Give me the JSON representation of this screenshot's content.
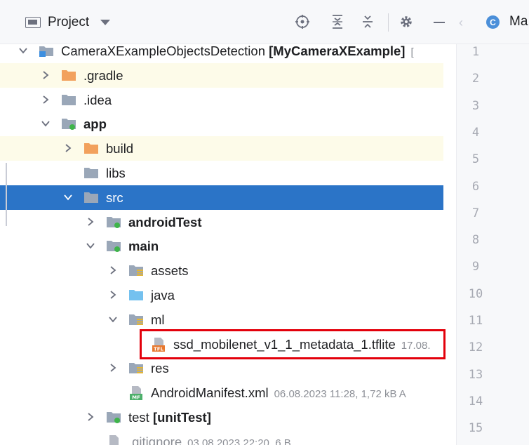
{
  "header": {
    "project_label": "Project",
    "icons": [
      "target-icon",
      "expand-all-icon",
      "collapse-all-icon",
      "gear-icon",
      "minimize-icon"
    ]
  },
  "tree": [
    {
      "name": "tree-row-project-root",
      "expanded": true,
      "icon": "project-folder-icon",
      "label": "CameraXExampleObjectsDetection",
      "extra": "[MyCameraXExample]",
      "meta": "[",
      "bold": false
    },
    {
      "name": "tree-row-gradle",
      "expanded": false,
      "icon": "orange-folder-icon",
      "label": ".gradle",
      "highlight": true
    },
    {
      "name": "tree-row-idea",
      "expanded": false,
      "icon": "gray-folder-icon",
      "label": ".idea"
    },
    {
      "name": "tree-row-app",
      "expanded": true,
      "icon": "module-folder-icon",
      "label": "app",
      "bold": true
    },
    {
      "name": "tree-row-build",
      "expanded": false,
      "icon": "orange-folder-icon",
      "label": "build",
      "highlight": true
    },
    {
      "name": "tree-row-libs",
      "icon": "gray-folder-icon",
      "label": "libs"
    },
    {
      "name": "tree-row-src",
      "expanded": true,
      "icon": "gray-folder-icon",
      "label": "src",
      "selected": true
    },
    {
      "name": "tree-row-androidtest",
      "expanded": false,
      "icon": "module-folder-icon",
      "label": "androidTest",
      "bold": true
    },
    {
      "name": "tree-row-main",
      "expanded": true,
      "icon": "module-folder-icon",
      "label": "main",
      "bold": true
    },
    {
      "name": "tree-row-assets",
      "expanded": false,
      "icon": "resource-folder-icon",
      "label": "assets"
    },
    {
      "name": "tree-row-java",
      "expanded": false,
      "icon": "source-folder-icon",
      "label": "java"
    },
    {
      "name": "tree-row-ml",
      "expanded": true,
      "icon": "resource-folder-icon",
      "label": "ml"
    },
    {
      "name": "tree-row-tflite",
      "icon": "tflite-file-icon",
      "label": "ssd_mobilenet_v1_1_metadata_1.tflite",
      "meta": "17.08."
    },
    {
      "name": "tree-row-res",
      "expanded": false,
      "icon": "resource-folder-icon",
      "label": "res"
    },
    {
      "name": "tree-row-manifest",
      "icon": "manifest-file-icon",
      "label": "AndroidManifest.xml",
      "meta": "06.08.2023 11:28, 1,72 kB A"
    },
    {
      "name": "tree-row-test",
      "expanded": false,
      "icon": "module-folder-icon",
      "label": "test",
      "extra": "[unitTest]"
    },
    {
      "name": "tree-row-gitignore",
      "icon": "gitignore-file-icon",
      "label": ".gitignore",
      "meta": "03.08.2023 22:20, 6 B"
    }
  ],
  "editor": {
    "tab_title": "Ma",
    "class_icon_letter": "C",
    "line_numbers": [
      "1",
      "2",
      "3",
      "4",
      "5",
      "6",
      "7",
      "8",
      "9",
      "10",
      "11",
      "12",
      "13",
      "14",
      "15"
    ]
  },
  "colors": {
    "selection": "#2b74c7",
    "highlight": "#fdfbe9",
    "annotation_box": "#e3000b"
  }
}
